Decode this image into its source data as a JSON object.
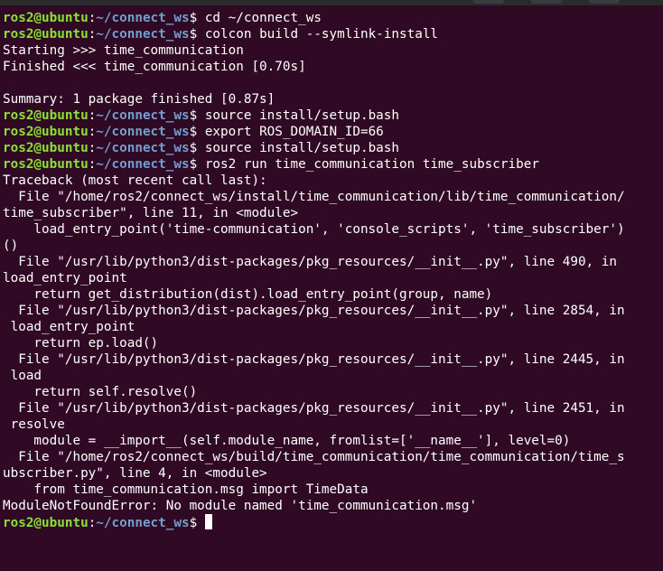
{
  "theme": {
    "background": "#300a24",
    "text": "#ffffff",
    "prompt_user_color": "#8ae234",
    "prompt_path_color": "#729fcf"
  },
  "prompt": {
    "user_host": "ros2@ubuntu",
    "colon": ":",
    "path": "~/connect_ws",
    "dollar": "$ "
  },
  "lines": [
    {
      "type": "prompt",
      "command": "cd ~/connect_ws"
    },
    {
      "type": "prompt",
      "command": "colcon build --symlink-install"
    },
    {
      "type": "output",
      "text": "Starting >>> time_communication"
    },
    {
      "type": "output",
      "text": "Finished <<< time_communication [0.70s]"
    },
    {
      "type": "output",
      "text": ""
    },
    {
      "type": "output",
      "text": "Summary: 1 package finished [0.87s]"
    },
    {
      "type": "prompt",
      "command": "source install/setup.bash"
    },
    {
      "type": "prompt",
      "command": "export ROS_DOMAIN_ID=66"
    },
    {
      "type": "prompt",
      "command": "source install/setup.bash"
    },
    {
      "type": "prompt",
      "command": "ros2 run time_communication time_subscriber"
    },
    {
      "type": "output",
      "text": "Traceback (most recent call last):"
    },
    {
      "type": "output",
      "text": "  File \"/home/ros2/connect_ws/install/time_communication/lib/time_communication/"
    },
    {
      "type": "output",
      "text": "time_subscriber\", line 11, in <module>"
    },
    {
      "type": "output",
      "text": "    load_entry_point('time-communication', 'console_scripts', 'time_subscriber')"
    },
    {
      "type": "output",
      "text": "()"
    },
    {
      "type": "output",
      "text": "  File \"/usr/lib/python3/dist-packages/pkg_resources/__init__.py\", line 490, in"
    },
    {
      "type": "output",
      "text": "load_entry_point"
    },
    {
      "type": "output",
      "text": "    return get_distribution(dist).load_entry_point(group, name)"
    },
    {
      "type": "output",
      "text": "  File \"/usr/lib/python3/dist-packages/pkg_resources/__init__.py\", line 2854, in"
    },
    {
      "type": "output",
      "text": " load_entry_point"
    },
    {
      "type": "output",
      "text": "    return ep.load()"
    },
    {
      "type": "output",
      "text": "  File \"/usr/lib/python3/dist-packages/pkg_resources/__init__.py\", line 2445, in"
    },
    {
      "type": "output",
      "text": " load"
    },
    {
      "type": "output",
      "text": "    return self.resolve()"
    },
    {
      "type": "output",
      "text": "  File \"/usr/lib/python3/dist-packages/pkg_resources/__init__.py\", line 2451, in"
    },
    {
      "type": "output",
      "text": " resolve"
    },
    {
      "type": "output",
      "text": "    module = __import__(self.module_name, fromlist=['__name__'], level=0)"
    },
    {
      "type": "output",
      "text": "  File \"/home/ros2/connect_ws/build/time_communication/time_communication/time_s"
    },
    {
      "type": "output",
      "text": "ubscriber.py\", line 4, in <module>"
    },
    {
      "type": "output",
      "text": "    from time_communication.msg import TimeData"
    },
    {
      "type": "output",
      "text": "ModuleNotFoundError: No module named 'time_communication.msg'"
    },
    {
      "type": "prompt_active",
      "command": ""
    }
  ]
}
